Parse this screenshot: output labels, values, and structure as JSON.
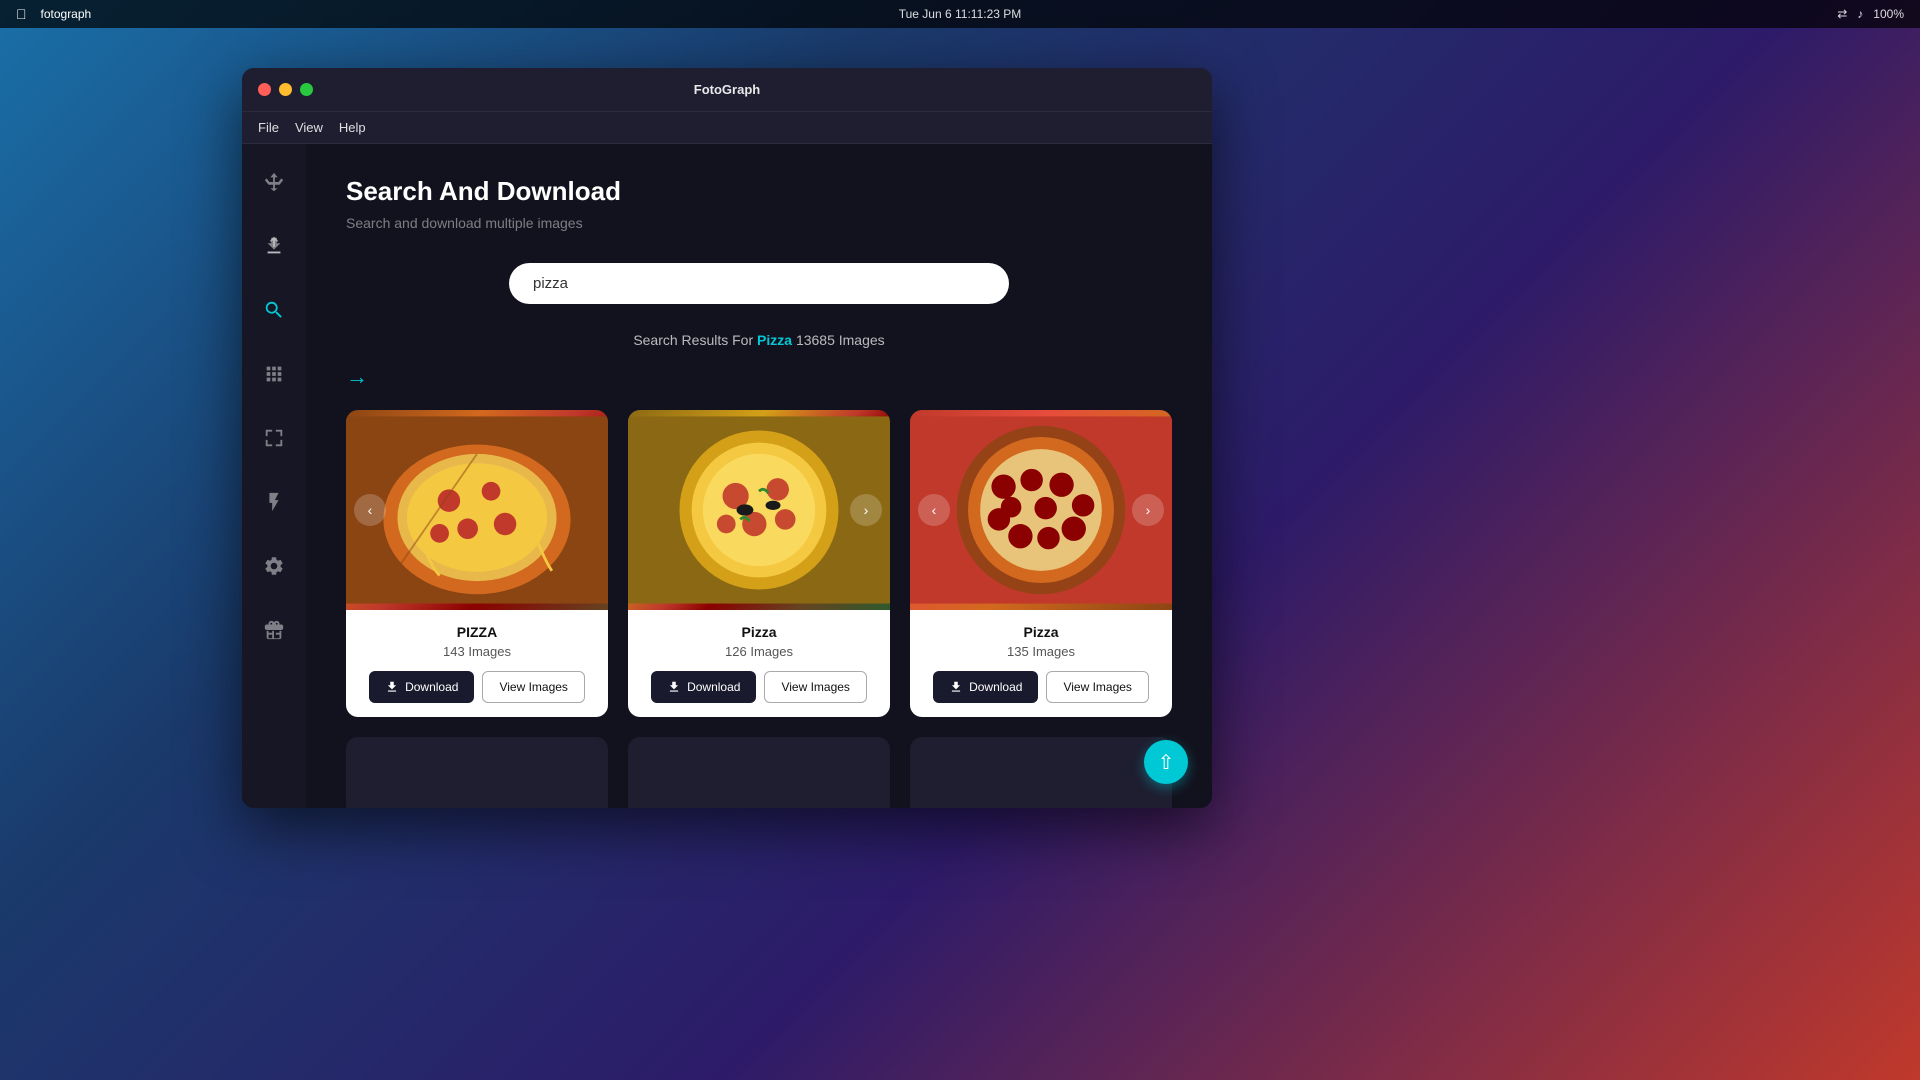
{
  "macos": {
    "datetime": "Tue Jun 6  11:11:23 PM",
    "battery": "100%",
    "app_name": "fotograph"
  },
  "window": {
    "title": "FotoGraph",
    "traffic_lights": [
      "close",
      "minimize",
      "maximize"
    ]
  },
  "menu": {
    "items": [
      "File",
      "View",
      "Help"
    ]
  },
  "sidebar": {
    "icons": [
      {
        "name": "recycle-icon",
        "symbol": "♻",
        "active": false
      },
      {
        "name": "upload-icon",
        "symbol": "⬆",
        "active": false
      },
      {
        "name": "search-icon",
        "symbol": "🔍",
        "active": true
      },
      {
        "name": "grid-compress-icon",
        "symbol": "⊞",
        "active": false
      },
      {
        "name": "grid-expand-icon",
        "symbol": "⊟",
        "active": false
      },
      {
        "name": "lightning-icon",
        "symbol": "⚡",
        "active": false
      },
      {
        "name": "settings-icon",
        "symbol": "⚙",
        "active": false
      },
      {
        "name": "gift-icon",
        "symbol": "🎁",
        "active": false
      }
    ]
  },
  "page": {
    "title": "Search And Download",
    "subtitle": "Search and download multiple images",
    "search": {
      "value": "pizza",
      "placeholder": "pizza"
    },
    "results": {
      "prefix": "Search Results For",
      "keyword": "Pizza",
      "count": "13685 Images"
    }
  },
  "cards": [
    {
      "title": "PIZZA",
      "count": "143 Images",
      "download_label": "Download",
      "view_label": "View Images",
      "theme": "pizza-1"
    },
    {
      "title": "Pizza",
      "count": "126 Images",
      "download_label": "Download",
      "view_label": "View Images",
      "theme": "pizza-2"
    },
    {
      "title": "Pizza",
      "count": "135 Images",
      "download_label": "Download",
      "view_label": "View Images",
      "theme": "pizza-3"
    }
  ],
  "bottom_cards": [
    {
      "theme": "pizza-4"
    },
    {
      "theme": "pizza-5"
    },
    {
      "theme": "pizza-6"
    }
  ]
}
